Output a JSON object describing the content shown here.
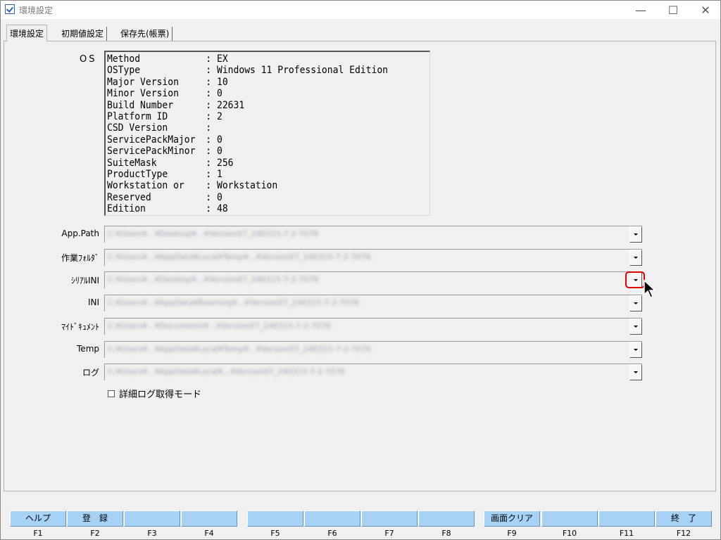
{
  "window": {
    "title": "環境設定"
  },
  "tabs": [
    {
      "label": "環境設定",
      "active": true
    },
    {
      "label": "初期値設定",
      "active": false
    },
    {
      "label": "保存先(帳票)",
      "active": false
    }
  ],
  "os": {
    "label": "OS",
    "rows": [
      {
        "key": "Method",
        "value": "EX"
      },
      {
        "key": "OSType",
        "value": "Windows 11 Professional Edition"
      },
      {
        "key": "Major Version",
        "value": "10"
      },
      {
        "key": "Minor Version",
        "value": "0"
      },
      {
        "key": "Build Number",
        "value": "22631"
      },
      {
        "key": "Platform ID",
        "value": "2"
      },
      {
        "key": "CSD Version",
        "value": ""
      },
      {
        "key": "ServicePackMajor",
        "value": "0"
      },
      {
        "key": "ServicePackMinor",
        "value": "0"
      },
      {
        "key": "SuiteMask",
        "value": "256"
      },
      {
        "key": "ProductType",
        "value": "1"
      },
      {
        "key": "Workstation or",
        "value": "Workstation"
      },
      {
        "key": "Reserved",
        "value": "0"
      },
      {
        "key": "Edition",
        "value": "48"
      }
    ]
  },
  "fields": [
    {
      "label": "App.Path",
      "value": "C:¥Users¥...¥Desktop¥...¥Version07_240315-7-2-7076"
    },
    {
      "label": "作業ﾌｫﾙﾀﾞ",
      "value": "C:¥Users¥...¥AppData¥Local¥Temp¥...¥Version07_240315-7-2-7076"
    },
    {
      "label": "ｼﾘｱﾙINI",
      "value": "C:¥Users¥...¥Desktop¥...¥Version07_240315-7-2-7076"
    },
    {
      "label": "INI",
      "value": "C:¥Users¥...¥AppData¥Roaming¥...¥Version07_240315-7-2-7076"
    },
    {
      "label": "ﾏｲﾄﾞｷｭﾒﾝﾄ",
      "value": "C:¥Users¥...¥Documents¥...¥Version07_240315-7-2-7076"
    },
    {
      "label": "Temp",
      "value": "C:¥Users¥...¥AppData¥Local¥Temp¥...¥Version07_240315-7-2-7076"
    },
    {
      "label": "ログ",
      "value": "C:¥Users¥...¥AppData¥Local¥...¥Version07_240315-7-2-7076"
    }
  ],
  "detail_log": {
    "label": "詳細ログ取得モード",
    "checked": false
  },
  "fkeys": [
    {
      "label": "ヘルプ",
      "key": "F1"
    },
    {
      "label": "登　録",
      "key": "F2"
    },
    {
      "label": "",
      "key": "F3"
    },
    {
      "label": "",
      "key": "F4"
    },
    {
      "label": "",
      "key": "F5"
    },
    {
      "label": "",
      "key": "F6"
    },
    {
      "label": "",
      "key": "F7"
    },
    {
      "label": "",
      "key": "F8"
    },
    {
      "label": "画面クリア",
      "key": "F9"
    },
    {
      "label": "",
      "key": "F10"
    },
    {
      "label": "",
      "key": "F11"
    },
    {
      "label": "終　了",
      "key": "F12"
    }
  ],
  "colors": {
    "fkey_bg": "#a5d2f5",
    "highlight": "#e00000"
  }
}
